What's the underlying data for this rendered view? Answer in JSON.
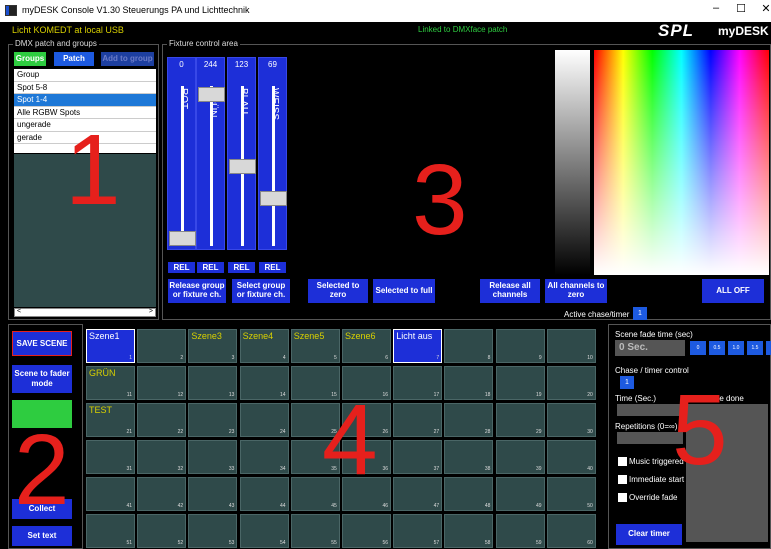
{
  "titlebar": {
    "title": "myDESK Console V1.30  Steuerungs PA und Lichttechnik",
    "min": "–",
    "max": "☐",
    "close": "✕"
  },
  "header": {
    "status": "Licht KOMEDT at local USB",
    "link": "Linked to DMXface patch",
    "logo": "SPL",
    "brand": "myDESK"
  },
  "patch": {
    "legend": "DMX patch and groups",
    "tabs": [
      "Groups",
      "Patch",
      "Add to group"
    ],
    "items": [
      "Group",
      "Spot 5-8",
      "Spot 1-4",
      "Alle RGBW Spots",
      "ungerade",
      "gerade"
    ],
    "selected_index": 2,
    "scroll_left": "<",
    "scroll_right": ">"
  },
  "fixture": {
    "legend": "Fixture control area",
    "faders": [
      {
        "value": "0",
        "label": "ROT",
        "level": 0
      },
      {
        "value": "244",
        "label": "GRÜN",
        "level": 0.96
      },
      {
        "value": "123",
        "label": "BLAU",
        "level": 0.48
      },
      {
        "value": "69",
        "label": "WEISS",
        "level": 0.27
      }
    ],
    "rel_label": "REL",
    "buttons": [
      "Release group or fixture ch.",
      "Select group or fixture ch.",
      "Selected to zero",
      "Selected to full",
      "Release all channels",
      "All channels to zero",
      "ALL OFF"
    ],
    "active_chase_label": "Active chase/timer",
    "active_chase_value": "1"
  },
  "left_buttons": {
    "save": "SAVE SCENE",
    "fader": "Scene to fader mode",
    "green": "",
    "collect": "Collect",
    "settext": "Set text"
  },
  "scenes": {
    "labels": {
      "1": "Szene1",
      "3": "Szene3",
      "4": "Szene4",
      "5": "Szene5",
      "6": "Szene6",
      "7": "Licht aus",
      "11": "GRÜN",
      "21": "TEST"
    },
    "active": [
      1,
      7
    ],
    "yellow": [
      3,
      4,
      5,
      6,
      11,
      21
    ]
  },
  "timer": {
    "fade_label": "Scene fade time (sec)",
    "fade_value": "0 Sec.",
    "fade_steps": [
      "0",
      "0.5",
      "1.0",
      "1.5",
      "2"
    ],
    "chase_label": "Chase / timer control",
    "chase_value": "1",
    "time_label": "Time (Sec.)",
    "cells_label": "Cells to be done",
    "rep_label": "Repetitions (0=∞)",
    "music": "Music triggered",
    "immediate": "Immediate start",
    "override": "Override fade",
    "clear": "Clear timer"
  },
  "overlay_numbers": [
    "1",
    "2",
    "3",
    "4",
    "5"
  ]
}
